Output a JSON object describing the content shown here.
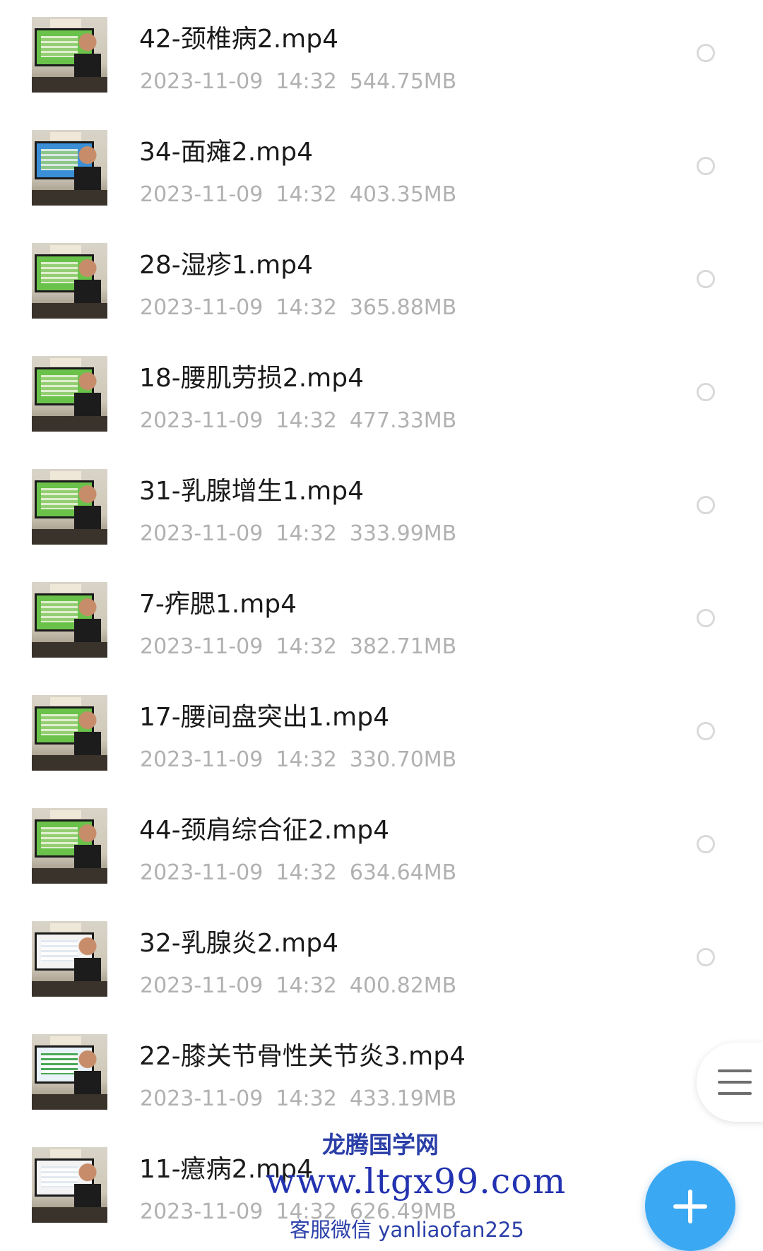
{
  "files": [
    {
      "name": "42-颈椎病2.mp4",
      "date": "2023-11-09",
      "time": "14:32",
      "size": "544.75MB",
      "thumbnail": "video-thumbnail"
    },
    {
      "name": "34-面瘫2.mp4",
      "date": "2023-11-09",
      "time": "14:32",
      "size": "403.35MB",
      "thumbnail": "video-thumbnail"
    },
    {
      "name": "28-湿疹1.mp4",
      "date": "2023-11-09",
      "time": "14:32",
      "size": "365.88MB",
      "thumbnail": "video-thumbnail"
    },
    {
      "name": "18-腰肌劳损2.mp4",
      "date": "2023-11-09",
      "time": "14:32",
      "size": "477.33MB",
      "thumbnail": "video-thumbnail"
    },
    {
      "name": "31-乳腺增生1.mp4",
      "date": "2023-11-09",
      "time": "14:32",
      "size": "333.99MB",
      "thumbnail": "video-thumbnail"
    },
    {
      "name": "7-痄腮1.mp4",
      "date": "2023-11-09",
      "time": "14:32",
      "size": "382.71MB",
      "thumbnail": "video-thumbnail"
    },
    {
      "name": "17-腰间盘突出1.mp4",
      "date": "2023-11-09",
      "time": "14:32",
      "size": "330.70MB",
      "thumbnail": "video-thumbnail"
    },
    {
      "name": "44-颈肩综合征2.mp4",
      "date": "2023-11-09",
      "time": "14:32",
      "size": "634.64MB",
      "thumbnail": "video-thumbnail"
    },
    {
      "name": "32-乳腺炎2.mp4",
      "date": "2023-11-09",
      "time": "14:32",
      "size": "400.82MB",
      "thumbnail": "video-thumbnail"
    },
    {
      "name": "22-膝关节骨性关节炎3.mp4",
      "date": "2023-11-09",
      "time": "14:32",
      "size": "433.19MB",
      "thumbnail": "video-thumbnail"
    },
    {
      "name": "11-癔病2.mp4",
      "date": "2023-11-09",
      "time": "14:32",
      "size": "626.49MB",
      "thumbnail": "video-thumbnail"
    }
  ],
  "icons": {
    "select": "radio-icon",
    "menu": "menu-icon",
    "add": "plus-icon"
  },
  "colors": {
    "accent": "#3aa8f2",
    "title_text": "#1a1a1a",
    "meta_text": "#b1b1b1",
    "watermark": "#2232b0"
  },
  "watermark": {
    "site_name": "龙腾国学网",
    "url": "www.ltgx99.com",
    "contact": "客服微信 yanliaofan225"
  }
}
